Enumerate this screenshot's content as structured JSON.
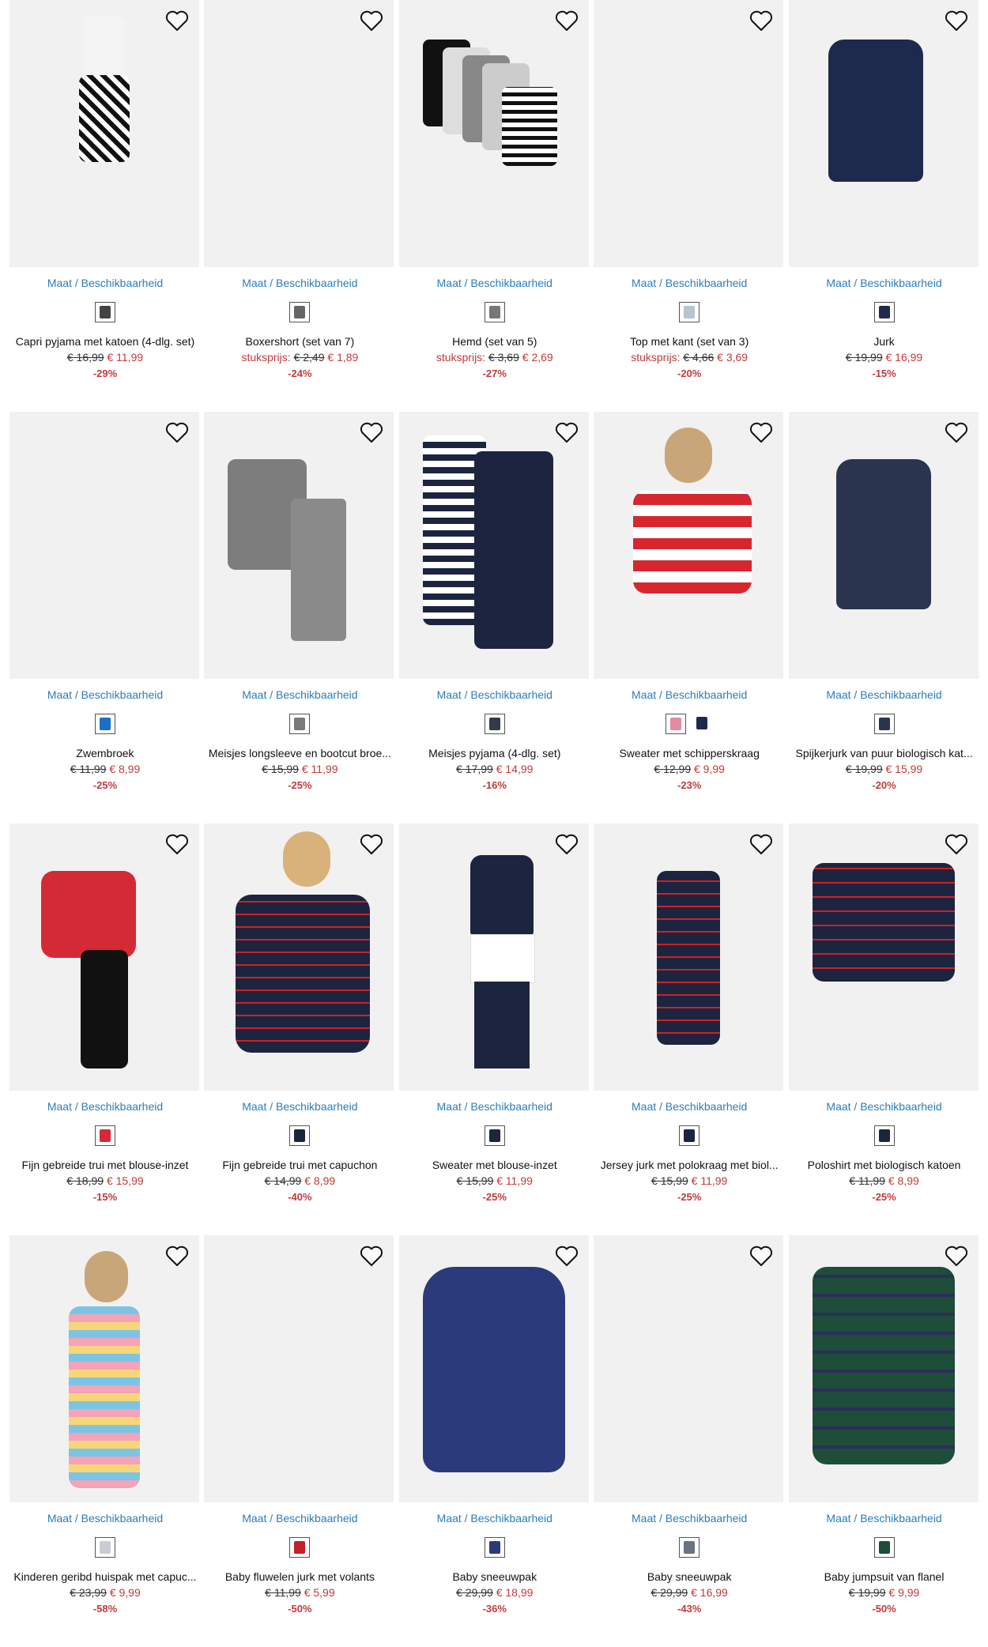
{
  "avail_label": "Maat / Beschikbaarheid",
  "unit_label": "stuksprijs:",
  "products": [
    {
      "title": "Capri pyjama met katoen (4-dlg. set)",
      "old": "€ 16,99",
      "new": "€ 11,99",
      "disc": "-29%",
      "unit": false,
      "colors": [
        "#444444"
      ]
    },
    {
      "title": "Boxershort (set van 7)",
      "old": "€ 2,49",
      "new": "€ 1,89",
      "disc": "-24%",
      "unit": true,
      "colors": [
        "#666666"
      ]
    },
    {
      "title": "Hemd (set van 5)",
      "old": "€ 3,69",
      "new": "€ 2,69",
      "disc": "-27%",
      "unit": true,
      "colors": [
        "#777777"
      ]
    },
    {
      "title": "Top met kant (set van 3)",
      "old": "€ 4,66",
      "new": "€ 3,69",
      "disc": "-20%",
      "unit": true,
      "colors": [
        "#b8c4cf"
      ]
    },
    {
      "title": "Jurk",
      "old": "€ 19,99",
      "new": "€ 16,99",
      "disc": "-15%",
      "unit": false,
      "colors": [
        "#1d2a4d"
      ]
    },
    {
      "title": "Zwembroek",
      "old": "€ 11,99",
      "new": "€ 8,99",
      "disc": "-25%",
      "unit": false,
      "colors": [
        "#1b6fc9"
      ]
    },
    {
      "title": "Meisjes longsleeve en bootcut broe...",
      "old": "€ 15,99",
      "new": "€ 11,99",
      "disc": "-25%",
      "unit": false,
      "colors": [
        "#7a7a7a"
      ]
    },
    {
      "title": "Meisjes pyjama (4-dlg. set)",
      "old": "€ 17,99",
      "new": "€ 14,99",
      "disc": "-16%",
      "unit": false,
      "colors": [
        "#333a48"
      ]
    },
    {
      "title": "Sweater met schipperskraag",
      "old": "€ 12,99",
      "new": "€ 9,99",
      "disc": "-23%",
      "unit": false,
      "colors": [
        "#e58aa0",
        "#1d2a4d"
      ]
    },
    {
      "title": "Spijkerjurk van puur biologisch kat...",
      "old": "€ 19,99",
      "new": "€ 15,99",
      "disc": "-20%",
      "unit": false,
      "colors": [
        "#2b3550"
      ]
    },
    {
      "title": "Fijn gebreide trui met blouse-inzet",
      "old": "€ 18,99",
      "new": "€ 15,99",
      "disc": "-15%",
      "unit": false,
      "colors": [
        "#d42a35"
      ]
    },
    {
      "title": "Fijn gebreide trui met capuchon",
      "old": "€ 14,99",
      "new": "€ 8,99",
      "disc": "-40%",
      "unit": false,
      "colors": [
        "#1d2440"
      ]
    },
    {
      "title": "Sweater met blouse-inzet",
      "old": "€ 15,99",
      "new": "€ 11,99",
      "disc": "-25%",
      "unit": false,
      "colors": [
        "#1d2440"
      ]
    },
    {
      "title": "Jersey jurk met polokraag met biol...",
      "old": "€ 15,99",
      "new": "€ 11,99",
      "disc": "-25%",
      "unit": false,
      "colors": [
        "#1d2440"
      ]
    },
    {
      "title": "Poloshirt met biologisch katoen",
      "old": "€ 11,99",
      "new": "€ 8,99",
      "disc": "-25%",
      "unit": false,
      "colors": [
        "#1d2440"
      ]
    },
    {
      "title": "Kinderen geribd huispak met capuc...",
      "old": "€ 23,99",
      "new": "€ 9,99",
      "disc": "-58%",
      "unit": false,
      "colors": [
        "#c9cdd3"
      ]
    },
    {
      "title": "Baby fluwelen jurk met volants",
      "old": "€ 11,99",
      "new": "€ 5,99",
      "disc": "-50%",
      "unit": false,
      "colors": [
        "#c8202a"
      ]
    },
    {
      "title": "Baby sneeuwpak",
      "old": "€ 29,99",
      "new": "€ 18,99",
      "disc": "-36%",
      "unit": false,
      "colors": [
        "#2a3a7a"
      ]
    },
    {
      "title": "Baby sneeuwpak",
      "old": "€ 29,99",
      "new": "€ 16,99",
      "disc": "-43%",
      "unit": false,
      "colors": [
        "#6b7280"
      ]
    },
    {
      "title": "Baby jumpsuit van flanel",
      "old": "€ 19,99",
      "new": "€ 9,99",
      "disc": "-50%",
      "unit": false,
      "colors": [
        "#1e4d3a"
      ]
    }
  ]
}
